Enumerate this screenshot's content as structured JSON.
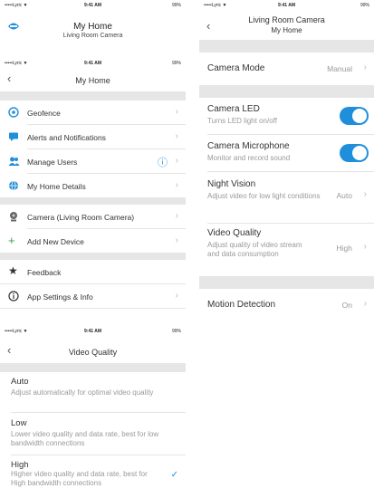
{
  "colors": {
    "accent": "#1f8fdc",
    "text": "#333333",
    "muted": "#999999",
    "separator": "#e6e6e6"
  },
  "top_left": {
    "status": {
      "carrier": "•••••Lyric ▼",
      "time": "9:41 AM",
      "battery": "99%"
    },
    "title": "My Home",
    "subtitle": "Living Room Camera",
    "icon": "shield-logo-icon"
  },
  "home": {
    "status": {
      "carrier": "•••••Lyric ▼",
      "time": "9:41 AM",
      "battery": "99%"
    },
    "back": "‹",
    "title": "My Home",
    "items": [
      {
        "label": "Geofence",
        "icon": "geofence-icon"
      },
      {
        "label": "Alerts and Notifications",
        "icon": "alerts-icon"
      },
      {
        "label": "Manage Users",
        "icon": "users-icon",
        "badge": "ⓘ"
      },
      {
        "label": "My Home Details",
        "icon": "globe-icon"
      },
      {
        "label": "Camera (Living Room Camera)",
        "icon": "camera-icon"
      },
      {
        "label": "Add New Device",
        "icon": "plus-icon"
      },
      {
        "label": "Feedback",
        "icon": "star-icon"
      },
      {
        "label": "App Settings & Info",
        "icon": "info-icon"
      }
    ]
  },
  "camera": {
    "status": {
      "carrier": "•••••Lyric ▼",
      "time": "9:41 AM",
      "battery": "99%"
    },
    "back": "‹",
    "title": "Living Room Camera",
    "subtitle": "My Home",
    "mode": {
      "label": "Camera Mode",
      "value": "Manual"
    },
    "led": {
      "label": "Camera LED",
      "desc": "Turns LED light on/off",
      "on": true
    },
    "mic": {
      "label": "Camera Microphone",
      "desc": "Monitor and record sound",
      "on": true
    },
    "night": {
      "label": "Night Vision",
      "desc": "Adjust video for low light conditions",
      "value": "Auto"
    },
    "quality": {
      "label": "Video Quality",
      "desc": "Adjust quality of video stream and data consumption",
      "value": "High"
    },
    "motion": {
      "label": "Motion Detection",
      "value": "On"
    }
  },
  "video_quality": {
    "status": {
      "carrier": "•••••Lyric ▼",
      "time": "9:41 AM",
      "battery": "99%"
    },
    "back": "‹",
    "title": "Video Quality",
    "options": [
      {
        "title": "Auto",
        "desc": "Adjust automatically for optimal video quality",
        "selected": false
      },
      {
        "title": "Low",
        "desc": "Lower video quality and data rate, best for low bandwidth connections",
        "selected": false
      },
      {
        "title": "High",
        "desc": "Higher video quality and data rate, best for High bandwidth connections",
        "selected": true
      }
    ],
    "check": "✓"
  }
}
